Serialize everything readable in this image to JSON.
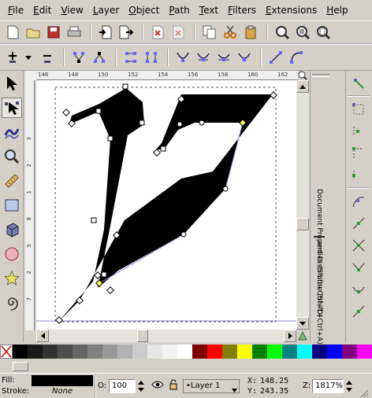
{
  "menu": [
    "File",
    "Edit",
    "View",
    "Layer",
    "Object",
    "Path",
    "Text",
    "Filters",
    "Extensions",
    "Help"
  ],
  "commands_toolbar": [
    "new-document-icon",
    "open-document-icon",
    "save-icon",
    "print-icon",
    "import-icon",
    "export-icon",
    "undo-icon",
    "redo-icon",
    "copy-icon",
    "cut-icon",
    "paste-icon",
    "zoom-selection-icon",
    "zoom-drawing-icon",
    "zoom-page-icon"
  ],
  "node_toolbar": [
    "add-node-icon",
    "delete-node-icon",
    "join-nodes-icon",
    "break-path-icon",
    "join-segment-icon",
    "delete-segment-icon",
    "cusp-node-icon",
    "smooth-node-icon",
    "symmetric-node-icon",
    "auto-smooth-node-icon",
    "segment-line-icon",
    "segment-curve-icon"
  ],
  "tools": [
    "selector-tool-icon",
    "node-tool-icon",
    "tweak-tool-icon",
    "zoom-tool-icon",
    "measure-tool-icon",
    "rectangle-tool-icon",
    "box-3d-tool-icon",
    "ellipse-tool-icon",
    "star-tool-icon",
    "spiral-tool-icon"
  ],
  "ruler": {
    "h_labels": [
      "146",
      "148",
      "150",
      "152",
      "154",
      "156",
      "158",
      "160",
      "162"
    ],
    "v_labels": [
      "3",
      "2",
      "1",
      "8",
      "5",
      "2",
      "7"
    ]
  },
  "dock_tabs": [
    "Document Properties (Shift+Ctrl+D)",
    "and Distribute (Shift+Ctrl+A)"
  ],
  "snap_controls": [
    "snap-toggle-icon",
    "snap-bbox-icon",
    "snap-bbox-edge-icon",
    "snap-bbox-corner-icon",
    "snap-bbox-midpoint-icon",
    "snap-nodes-icon",
    "snap-paths-icon",
    "snap-intersection-icon",
    "snap-cusp-icon",
    "snap-smooth-icon",
    "snap-midpoint-icon",
    "snap-center-icon"
  ],
  "palette": {
    "none_label": "none-swatch",
    "colors": [
      "#000000",
      "#1a1a1a",
      "#333333",
      "#4d4d4d",
      "#666666",
      "#808080",
      "#999999",
      "#b3b3b3",
      "#cccccc",
      "#e6e6e6",
      "#f2f2f2",
      "#ffffff",
      "#800000",
      "#ff0000",
      "#808000",
      "#ffff00",
      "#008000",
      "#00ff00",
      "#008080",
      "#00ffff",
      "#000080",
      "#0000ff",
      "#800080",
      "#ff00ff"
    ]
  },
  "status": {
    "fill_label": "Fill:",
    "stroke_label": "Stroke:",
    "stroke_value": "None",
    "fill_color": "#000000",
    "opacity_label": "O:",
    "opacity_value": "100",
    "layer_value": "•Layer 1",
    "x_label": "X:",
    "x_value": "148.25",
    "y_label": "Y:",
    "y_value": "243.35",
    "zoom_label": "Z:",
    "zoom_value": "1817%"
  }
}
